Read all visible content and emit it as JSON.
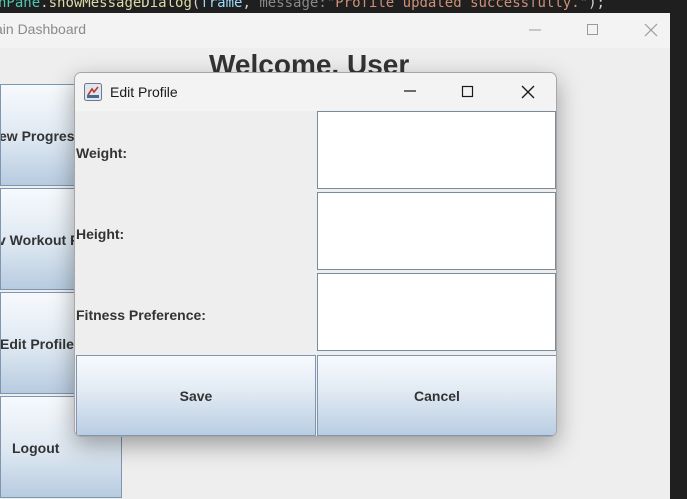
{
  "code_line": {
    "p1": "nPane",
    "p2": ".",
    "p3": "showMessageDialog",
    "p4": "(",
    "p5": "frame",
    "p6": ", ",
    "p7": "message:",
    "p8": "\"Profile updated successfully.\"",
    "p9": ");"
  },
  "main_window": {
    "title": "ain Dashboard",
    "welcome": "Welcome, User",
    "sidebar": [
      {
        "label": "ew Progres"
      },
      {
        "label": "v Workout P"
      },
      {
        "label": "Edit Profile"
      },
      {
        "label": "Logout"
      }
    ]
  },
  "dialog": {
    "title": "Edit Profile",
    "fields": [
      {
        "label": "Weight:",
        "value": ""
      },
      {
        "label": "Height:",
        "value": ""
      },
      {
        "label": "Fitness Preference:",
        "value": ""
      }
    ],
    "save_label": "Save",
    "cancel_label": "Cancel"
  },
  "icons": {
    "minimize": "minimize-icon",
    "maximize": "maximize-icon",
    "close": "close-icon",
    "app": "java-app-icon"
  }
}
